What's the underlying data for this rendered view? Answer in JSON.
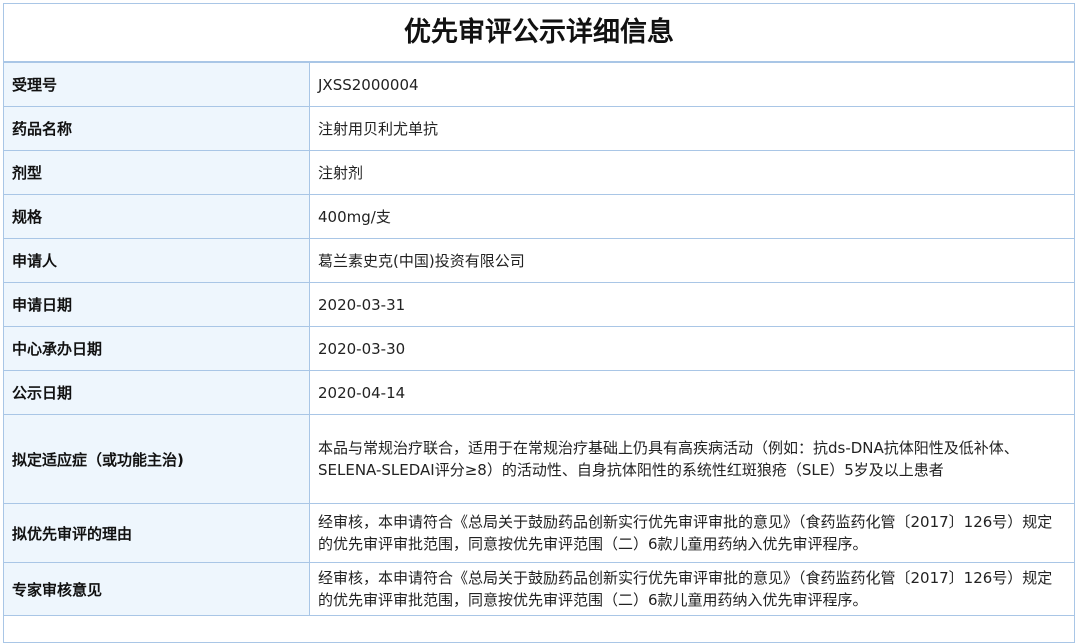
{
  "title": "优先审评公示详细信息",
  "rows": [
    {
      "label": "受理号",
      "value": "JXSS2000004"
    },
    {
      "label": "药品名称",
      "value": "注射用贝利尤单抗"
    },
    {
      "label": "剂型",
      "value": "注射剂"
    },
    {
      "label": "规格",
      "value": "400mg/支"
    },
    {
      "label": "申请人",
      "value": "葛兰素史克(中国)投资有限公司"
    },
    {
      "label": "申请日期",
      "value": "2020-03-31"
    },
    {
      "label": "中心承办日期",
      "value": "2020-03-30"
    },
    {
      "label": "公示日期",
      "value": "2020-04-14"
    },
    {
      "label": "拟定适应症（或功能主治)",
      "value": "本品与常规治疗联合，适用于在常规治疗基础上仍具有高疾病活动（例如：抗ds-DNA抗体阳性及低补体、SELENA-SLEDAI评分≥8）的活动性、自身抗体阳性的系统性红斑狼疮（SLE）5岁及以上患者"
    },
    {
      "label": "拟优先审评的理由",
      "value": "经审核，本申请符合《总局关于鼓励药品创新实行优先审评审批的意见》（食药监药化管〔2017〕126号）规定的优先审评审批范围，同意按优先审评范围（二）6款儿童用药纳入优先审评程序。"
    },
    {
      "label": "专家审核意见",
      "value": "经审核，本申请符合《总局关于鼓励药品创新实行优先审评审批的意见》（食药监药化管〔2017〕126号）规定的优先审评审批范围，同意按优先审评范围（二）6款儿童用药纳入优先审评程序。"
    }
  ]
}
